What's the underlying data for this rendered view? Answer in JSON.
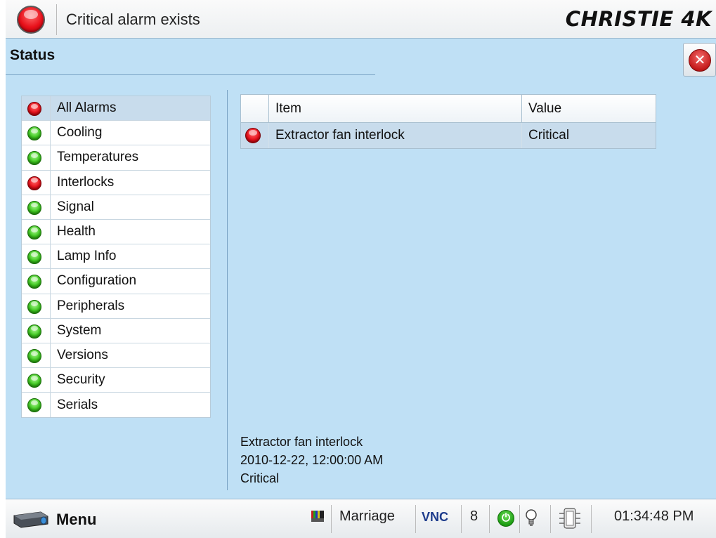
{
  "header": {
    "alarm_text": "Critical alarm exists",
    "brand": "CHRISTIE 4K",
    "alarm_icon": "red-led-icon"
  },
  "page": {
    "title": "Status",
    "close_icon": "close-icon"
  },
  "categories": [
    {
      "label": "All Alarms",
      "status": "red",
      "selected": true
    },
    {
      "label": "Cooling",
      "status": "green"
    },
    {
      "label": "Temperatures",
      "status": "green"
    },
    {
      "label": "Interlocks",
      "status": "red"
    },
    {
      "label": "Signal",
      "status": "green"
    },
    {
      "label": "Health",
      "status": "green"
    },
    {
      "label": "Lamp Info",
      "status": "green"
    },
    {
      "label": "Configuration",
      "status": "green"
    },
    {
      "label": "Peripherals",
      "status": "green"
    },
    {
      "label": "System",
      "status": "green"
    },
    {
      "label": "Versions",
      "status": "green"
    },
    {
      "label": "Security",
      "status": "green"
    },
    {
      "label": "Serials",
      "status": "green"
    }
  ],
  "table": {
    "columns": [
      "",
      "Item",
      "Value"
    ],
    "rows": [
      {
        "status": "red",
        "item": "Extractor fan interlock",
        "value": "Critical"
      }
    ]
  },
  "details": {
    "item": "Extractor fan interlock",
    "timestamp": "2010-12-22, 12:00:00 AM",
    "severity": "Critical"
  },
  "bottom_bar": {
    "menu_label": "Menu",
    "test_pattern_icon": "test-pattern-icon",
    "channel": "Marriage",
    "vnc": "VNC",
    "count": "8",
    "power_icon": "power-icon",
    "lamp_icon": "lamp-icon",
    "shutter_icon": "shutter-icon",
    "time": "01:34:48 PM"
  },
  "colors": {
    "background": "#bfe0f5",
    "selected_row": "#c8dcec",
    "status_red": "#e8101a",
    "status_green": "#3ec91f"
  }
}
